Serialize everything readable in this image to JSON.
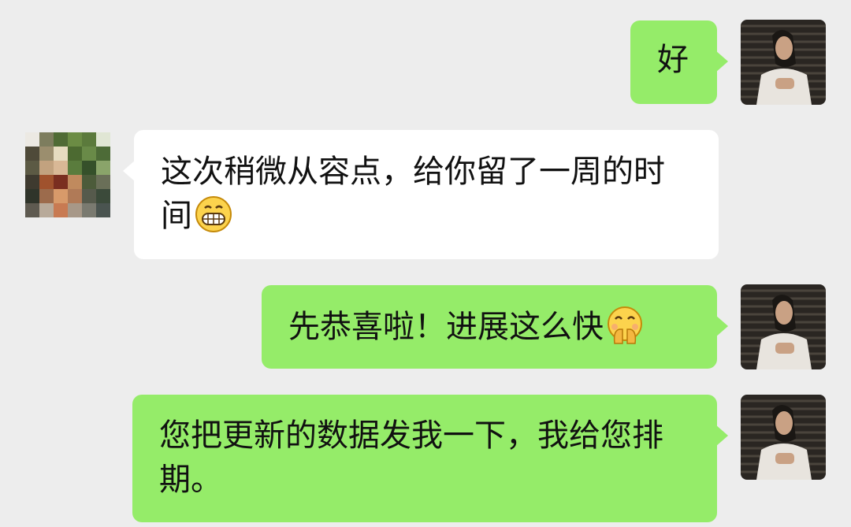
{
  "conversation": {
    "messages": [
      {
        "direction": "outgoing",
        "text": "好"
      },
      {
        "direction": "incoming",
        "text": "这次稍微从容点，给你留了一周的时间",
        "emoji": "grinning-face-icon"
      },
      {
        "direction": "outgoing",
        "text": "先恭喜啦！进展这么快",
        "emoji": "face-with-hand-over-mouth-icon"
      },
      {
        "direction": "outgoing",
        "text": "您把更新的数据发我一下，我给您排期。"
      }
    ]
  },
  "colors": {
    "background": "#ededed",
    "outgoing_bubble": "#95ec69",
    "incoming_bubble": "#ffffff",
    "text": "#111111"
  }
}
